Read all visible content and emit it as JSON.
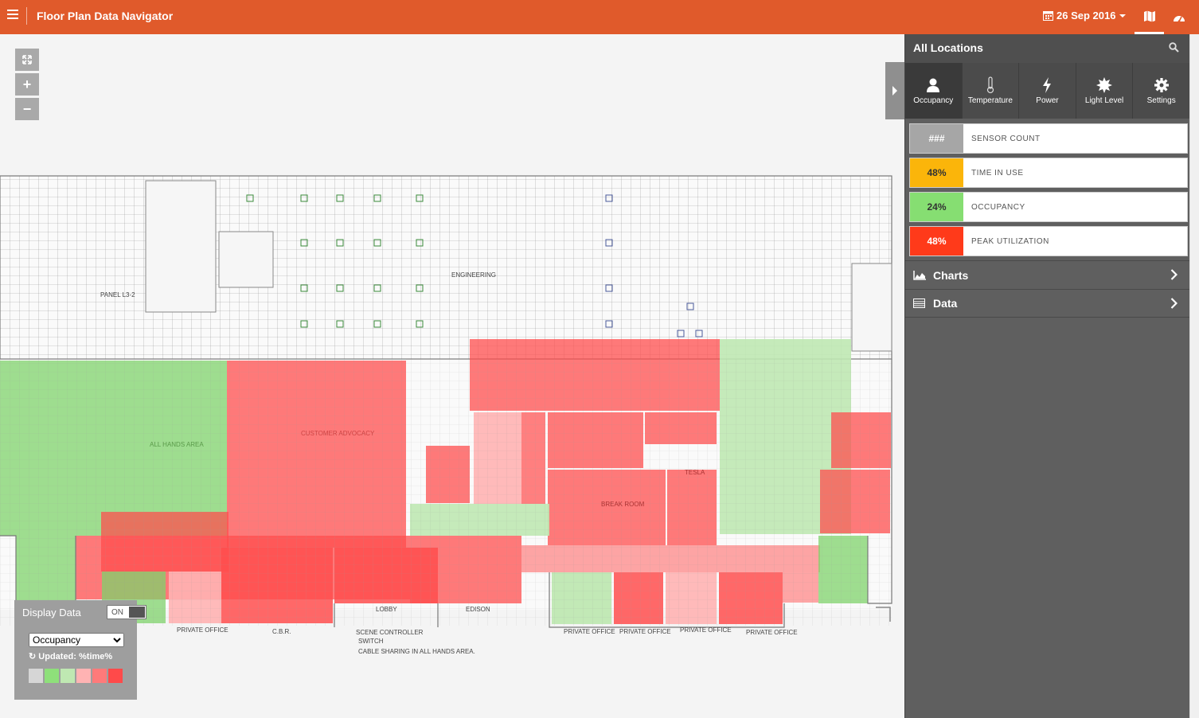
{
  "app": {
    "title": "Floor Plan Data Navigator",
    "date": "26 Sep 2016"
  },
  "sidebar": {
    "title": "All Locations",
    "tabs": [
      {
        "label": "Occupancy",
        "icon": "user-icon"
      },
      {
        "label": "Temperature",
        "icon": "thermometer-icon"
      },
      {
        "label": "Power",
        "icon": "lightning-icon"
      },
      {
        "label": "Light Level",
        "icon": "sun-icon"
      },
      {
        "label": "Settings",
        "icon": "gear-icon"
      }
    ],
    "metrics": [
      {
        "value": "###",
        "label": "SENSOR COUNT",
        "color": "#a6a6a6"
      },
      {
        "value": "48%",
        "label": "TIME IN USE",
        "color": "#fbb50a"
      },
      {
        "value": "24%",
        "label": "OCCUPANCY",
        "color": "#86de72"
      },
      {
        "value": "48%",
        "label": "PEAK UTILIZATION",
        "color": "#ff3a1a"
      }
    ],
    "sections": [
      {
        "label": "Charts",
        "icon": "area-chart-icon"
      },
      {
        "label": "Data",
        "icon": "table-icon"
      }
    ]
  },
  "display": {
    "label": "Display Data",
    "toggle": "ON",
    "selected": "Occupancy",
    "updated": "Updated: %time%",
    "swatches": [
      "#d6d6d6",
      "#8ee07a",
      "#bfe8b2",
      "#ffb3b3",
      "#ff7a7a",
      "#ff4a4a"
    ]
  },
  "floorplan": {
    "labels": [
      "PANEL L3-2",
      "ENGINEERING",
      "CUSTOMER ADVOCACY",
      "ALL HANDS AREA",
      "BREAK ROOM",
      "TESLA",
      "LOBBY",
      "EDISON",
      "PRIVATE OFFICE",
      "C.B.R.",
      "PRIVATE OFFICE",
      "PRIVATE OFFICE",
      "PRIVATE OFFICE",
      "PRIVATE OFFICE",
      "SCENE CONTROLLER",
      "SWITCH",
      "CABLE SHARING IN ALL HANDS AREA."
    ]
  }
}
